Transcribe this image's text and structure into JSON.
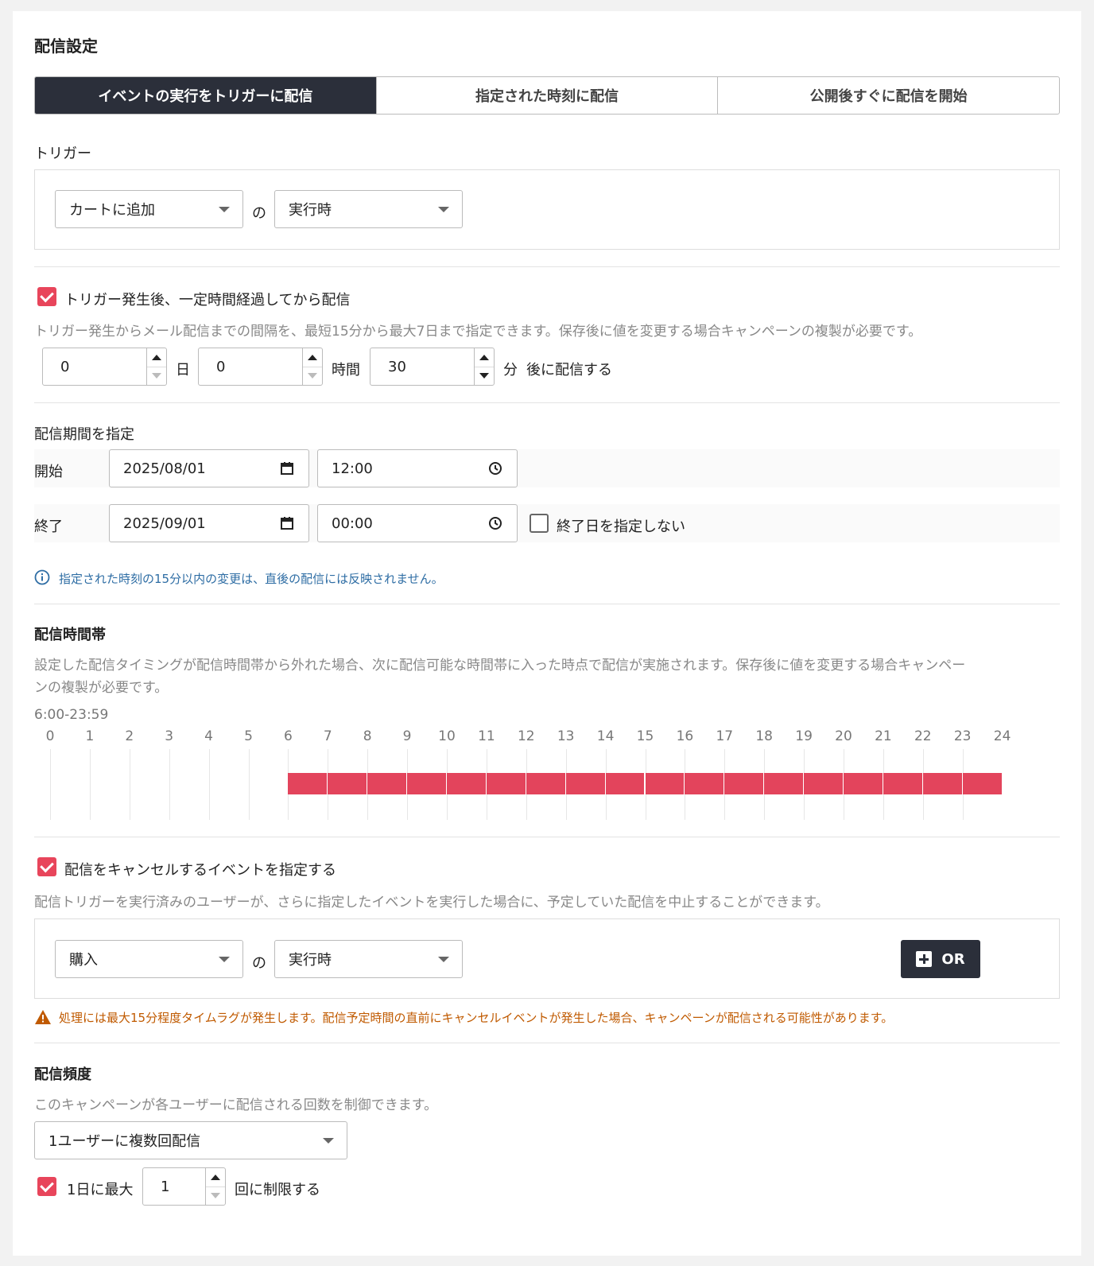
{
  "page_title": "配信設定",
  "tabs": [
    {
      "label": "イベントの実行をトリガーに配信",
      "active": true
    },
    {
      "label": "指定された時刻に配信",
      "active": false
    },
    {
      "label": "公開後すぐに配信を開始",
      "active": false
    }
  ],
  "trigger": {
    "heading": "トリガー",
    "event_select": "カートに追加",
    "connector": "の",
    "action_select": "実行時"
  },
  "delay": {
    "checkbox_label": "トリガー発生後、一定時間経過してから配信",
    "checked": true,
    "description": "トリガー発生からメール配信までの間隔を、最短15分から最大7日まで指定できます。保存後に値を変更する場合キャンペーンの複製が必要です。",
    "days_value": "0",
    "days_unit": "日",
    "hours_value": "0",
    "hours_unit": "時間",
    "minutes_value": "30",
    "minutes_unit": "分",
    "suffix": "後に配信する"
  },
  "period": {
    "heading": "配信期間を指定",
    "start_label": "開始",
    "start_date": "2025/08/01",
    "start_time": "12:00",
    "end_label": "終了",
    "end_date": "2025/09/01",
    "end_time": "00:00",
    "no_end_label": "終了日を指定しない",
    "no_end_checked": false,
    "info_text": "指定された時刻の15分以内の変更は、直後の配信には反映されません。"
  },
  "time_window": {
    "heading": "配信時間帯",
    "description_line1": "設定した配信タイミングが配信時間帯から外れた場合、次に配信可能な時間帯に入った時点で配信が実施されます。保存後に値を変更する場合キャンペー",
    "description_line2": "ンの複製が必要です。",
    "range_label": "6:00-23:59",
    "ticks": [
      "0",
      "1",
      "2",
      "3",
      "4",
      "5",
      "6",
      "7",
      "8",
      "9",
      "10",
      "11",
      "12",
      "13",
      "14",
      "15",
      "16",
      "17",
      "18",
      "19",
      "20",
      "21",
      "22",
      "23",
      "24"
    ],
    "active_hours": [
      6,
      7,
      8,
      9,
      10,
      11,
      12,
      13,
      14,
      15,
      16,
      17,
      18,
      19,
      20,
      21,
      22,
      23
    ],
    "bar_color": "#e3445c"
  },
  "cancel": {
    "checkbox_label": "配信をキャンセルするイベントを指定する",
    "checked": true,
    "description": "配信トリガーを実行済みのユーザーが、さらに指定したイベントを実行した場合に、予定していた配信を中止することができます。",
    "event_select": "購入",
    "connector": "の",
    "action_select": "実行時",
    "or_button": "OR",
    "warning_text": "処理には最大15分程度タイムラグが発生します。配信予定時間の直前にキャンセルイベントが発生した場合、キャンペーンが配信される可能性があります。"
  },
  "frequency": {
    "heading": "配信頻度",
    "description": "このキャンペーンが各ユーザーに配信される回数を制御できます。",
    "select": "1ユーザーに複数回配信",
    "limit_label": "1日に最大",
    "limit_checked": true,
    "limit_value": "1",
    "limit_suffix": "回に制限する"
  },
  "colors": {
    "accent": "#e8455b",
    "dark": "#2b2f3a",
    "info": "#2e6da4",
    "warning": "#c05a00"
  }
}
